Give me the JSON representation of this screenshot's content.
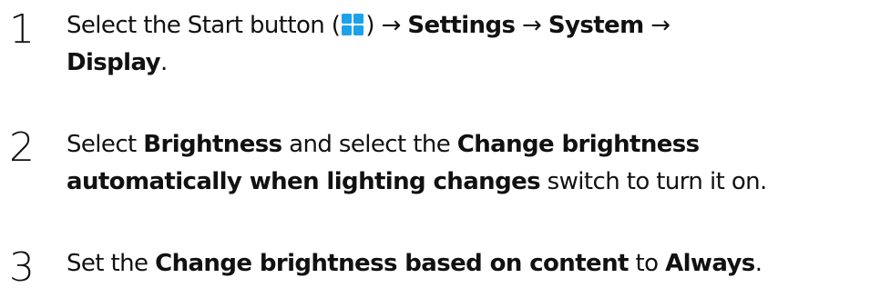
{
  "steps": [
    {
      "number": "1",
      "line1": {
        "t1": "Select the Start button (",
        "icon": "windows-start-icon",
        "t2": ") → ",
        "b1": "Settings",
        "t3": " → ",
        "b2": "System",
        "t4": " →"
      },
      "line2": {
        "b1": "Display",
        "t1": "."
      }
    },
    {
      "number": "2",
      "line1": {
        "t1": "Select ",
        "b1": "Brightness",
        "t2": " and select the ",
        "b2": "Change brightness"
      },
      "line2": {
        "b1": "automatically when lighting changes",
        "t1": " switch to turn it on."
      }
    },
    {
      "number": "3",
      "line1": {
        "t1": "Set the ",
        "b1": "Change brightness based on content",
        "t2": " to ",
        "b2": "Always",
        "t3": "."
      }
    }
  ],
  "colors": {
    "text": "#111111",
    "windows_icon_blue": "#1aa3ea"
  }
}
